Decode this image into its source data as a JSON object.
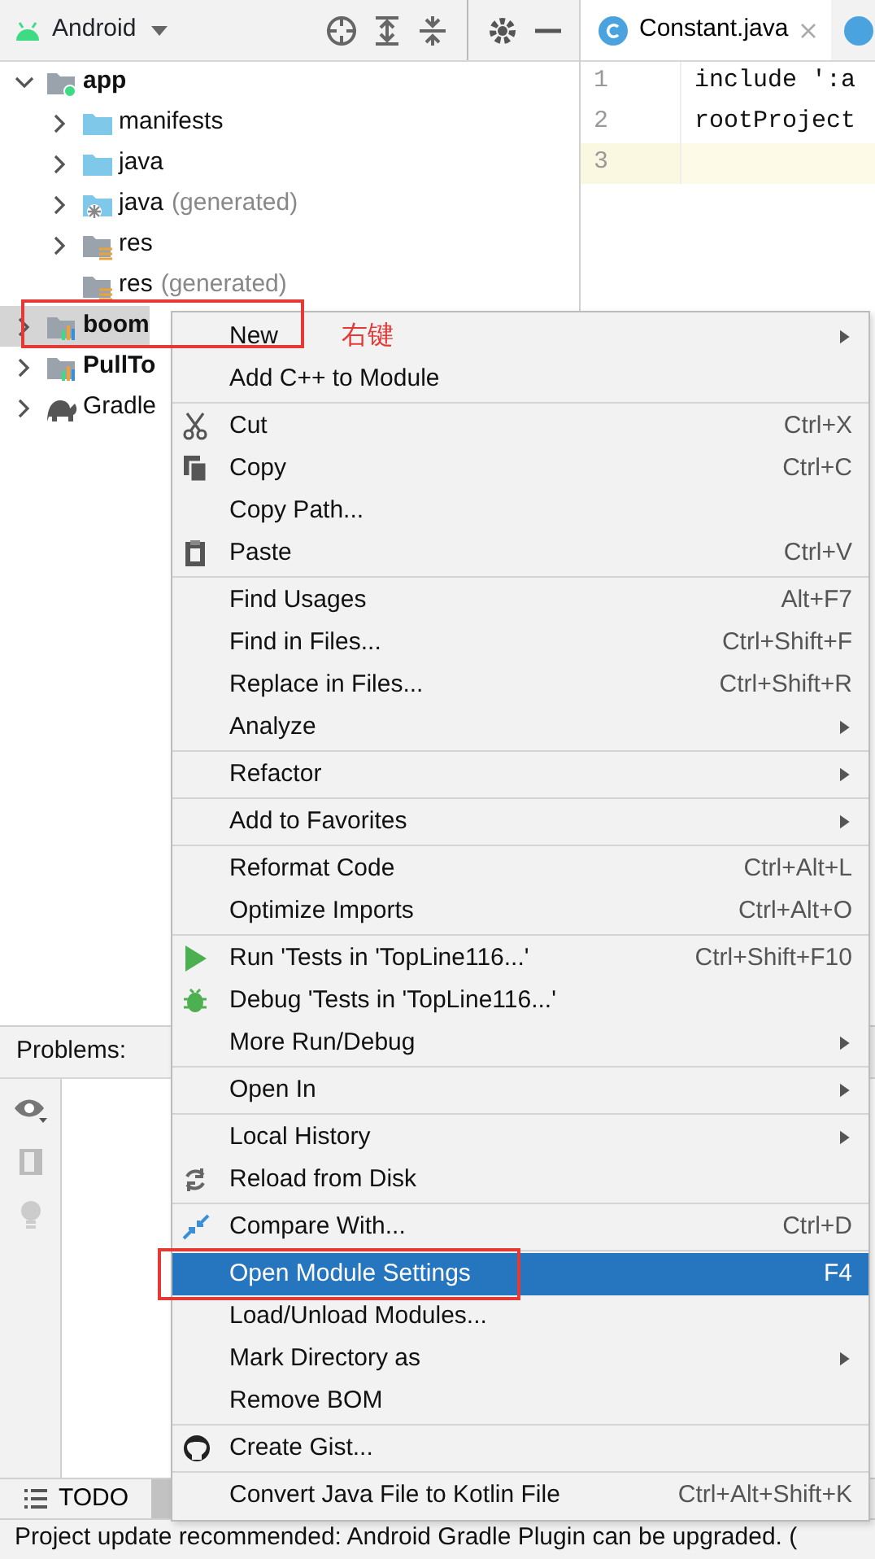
{
  "project_pane": {
    "view": "Android"
  },
  "tree": [
    {
      "label": "app",
      "kind": "app-module",
      "bold": true,
      "expandable": true,
      "expanded": true,
      "selected": false,
      "children": [
        {
          "label": "manifests",
          "kind": "folder",
          "bold": false,
          "expandable": true,
          "expanded": false,
          "selected": false
        },
        {
          "label": "java",
          "kind": "folder",
          "bold": false,
          "expandable": true,
          "expanded": false,
          "selected": false
        },
        {
          "label": "java",
          "note": "(generated)",
          "kind": "generated-folder",
          "bold": false,
          "expandable": true,
          "expanded": false,
          "selected": false
        },
        {
          "label": "res",
          "kind": "res-folder",
          "bold": false,
          "expandable": true,
          "expanded": false,
          "selected": false
        },
        {
          "label": "res",
          "note": "(generated)",
          "kind": "res-folder",
          "bold": false,
          "expandable": false,
          "selected": false
        }
      ]
    },
    {
      "label": "boom",
      "kind": "lib-module",
      "bold": true,
      "expandable": true,
      "expanded": false,
      "selected": true
    },
    {
      "label": "PullTo",
      "kind": "lib-module",
      "bold": true,
      "expandable": true,
      "expanded": false,
      "selected": false
    },
    {
      "label": "Gradle",
      "kind": "gradle",
      "bold": false,
      "expandable": true,
      "expanded": false,
      "selected": false
    }
  ],
  "editor": {
    "tabs": [
      {
        "label": "Constant.java",
        "selected": true
      }
    ],
    "lines": [
      {
        "number": "1",
        "code": "include ':a",
        "current": false
      },
      {
        "number": "2",
        "code": "rootProject",
        "current": false
      },
      {
        "number": "3",
        "current": true
      }
    ]
  },
  "context_menu": {
    "groups": [
      [
        {
          "label": "New",
          "submenu": true,
          "selected": false
        },
        {
          "label": "Add C++ to Module",
          "submenu": false,
          "selected": false
        }
      ],
      [
        {
          "label": "Cut",
          "kind": "cut",
          "shortcut": "Ctrl+X",
          "submenu": false,
          "selected": false
        },
        {
          "label": "Copy",
          "kind": "copy",
          "shortcut": "Ctrl+C",
          "submenu": false,
          "selected": false
        },
        {
          "label": "Copy Path...",
          "submenu": false,
          "selected": false
        },
        {
          "label": "Paste",
          "kind": "paste",
          "shortcut": "Ctrl+V",
          "submenu": false,
          "selected": false
        }
      ],
      [
        {
          "label": "Find Usages",
          "shortcut": "Alt+F7",
          "submenu": false,
          "selected": false
        },
        {
          "label": "Find in Files...",
          "shortcut": "Ctrl+Shift+F",
          "submenu": false,
          "selected": false
        },
        {
          "label": "Replace in Files...",
          "shortcut": "Ctrl+Shift+R",
          "submenu": false,
          "selected": false
        },
        {
          "label": "Analyze",
          "submenu": true,
          "selected": false
        }
      ],
      [
        {
          "label": "Refactor",
          "submenu": true,
          "selected": false
        }
      ],
      [
        {
          "label": "Add to Favorites",
          "submenu": true,
          "selected": false
        }
      ],
      [
        {
          "label": "Reformat Code",
          "shortcut": "Ctrl+Alt+L",
          "submenu": false,
          "selected": false
        },
        {
          "label": "Optimize Imports",
          "shortcut": "Ctrl+Alt+O",
          "submenu": false,
          "selected": false
        }
      ],
      [
        {
          "label": "Run 'Tests in 'TopLine116...'",
          "kind": "run",
          "shortcut": "Ctrl+Shift+F10",
          "submenu": false,
          "selected": false
        },
        {
          "label": "Debug 'Tests in 'TopLine116...'",
          "kind": "debug",
          "submenu": false,
          "selected": false
        },
        {
          "label": "More Run/Debug",
          "submenu": true,
          "selected": false
        }
      ],
      [
        {
          "label": "Open In",
          "submenu": true,
          "selected": false
        }
      ],
      [
        {
          "label": "Local History",
          "submenu": true,
          "selected": false
        },
        {
          "label": "Reload from Disk",
          "kind": "reload",
          "submenu": false,
          "selected": false
        }
      ],
      [
        {
          "label": "Compare With...",
          "kind": "compare",
          "shortcut": "Ctrl+D",
          "submenu": false,
          "selected": false
        }
      ],
      [
        {
          "label": "Open Module Settings",
          "shortcut": "F4",
          "submenu": false,
          "selected": true
        },
        {
          "label": "Load/Unload Modules...",
          "submenu": false,
          "selected": false
        },
        {
          "label": "Mark Directory as",
          "submenu": true,
          "selected": false
        },
        {
          "label": "Remove BOM",
          "submenu": false,
          "selected": false
        }
      ],
      [
        {
          "label": "Create Gist...",
          "kind": "github",
          "submenu": false,
          "selected": false
        }
      ],
      [
        {
          "label": "Convert Java File to Kotlin File",
          "shortcut": "Ctrl+Alt+Shift+K",
          "submenu": false,
          "selected": false
        }
      ]
    ]
  },
  "problems": {
    "title": "Problems:"
  },
  "bottom_tabs": [
    {
      "label": "TODO",
      "selected": false
    },
    {
      "selected": true
    }
  ],
  "annotations": [
    {
      "kind": "box"
    },
    {
      "kind": "text",
      "text": "右键"
    },
    {
      "kind": "box"
    }
  ],
  "status_bar": {
    "text": "Project update recommended: Android Gradle Plugin can be upgraded. ("
  }
}
